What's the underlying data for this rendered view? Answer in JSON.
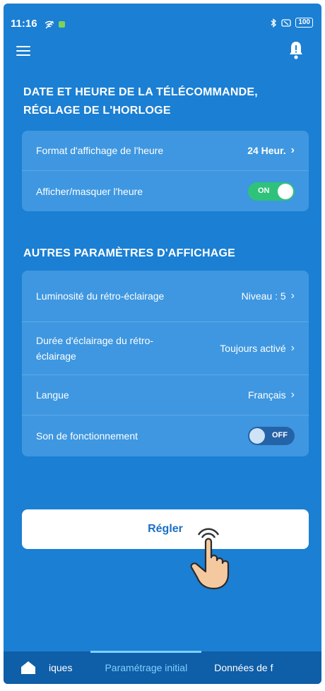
{
  "status_bar": {
    "time": "11:16",
    "battery": "100"
  },
  "section_clock": {
    "title": "DATE ET HEURE DE LA TÉLÉCOMMANDE, RÉGLAGE DE L'HORLOGE",
    "rows": [
      {
        "label": "Format d'affichage de l'heure",
        "value": "24 Heur."
      },
      {
        "label": "Afficher/masquer l'heure",
        "toggle": "ON"
      }
    ]
  },
  "section_display": {
    "title": "AUTRES PARAMÈTRES D'AFFICHAGE",
    "rows": [
      {
        "label": "Luminosité du rétro-éclairage",
        "value": "Niveau : 5"
      },
      {
        "label": "Durée d'éclairage du rétro-éclairage",
        "value": "Toujours activé"
      },
      {
        "label": "Langue",
        "value": "Français"
      },
      {
        "label": "Son de fonctionnement",
        "toggle": "OFF"
      }
    ]
  },
  "apply_button": "Régler",
  "tabs": [
    {
      "label": "iques"
    },
    {
      "label": "Paramétrage initial",
      "active": true
    },
    {
      "label": "Données de f"
    }
  ],
  "icons": {
    "menu": "menu-icon",
    "bell": "bell-icon",
    "home": "home-icon",
    "bluetooth": "bluetooth-icon",
    "hand_pointer": "hand-pointer-icon"
  },
  "colors": {
    "background": "#1b7fd3",
    "card": "#3e97e0",
    "toggle_on": "#2fc27a",
    "active_tab": "#7fd0ff"
  }
}
